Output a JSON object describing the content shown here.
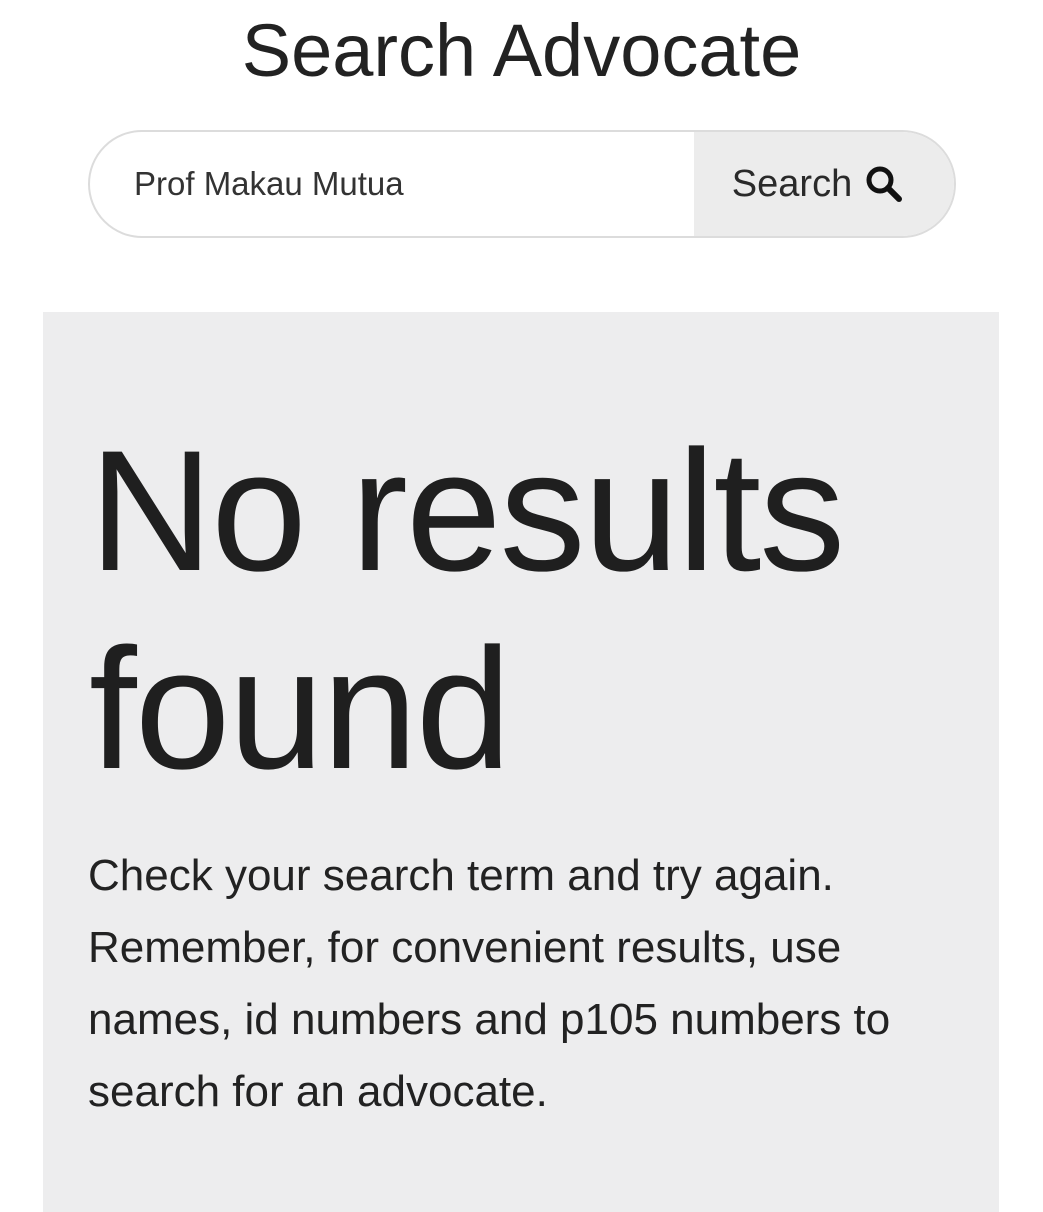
{
  "page": {
    "title": "Search Advocate"
  },
  "search": {
    "value": "Prof Makau Mutua",
    "button_label": "Search",
    "button_icon": "search-icon"
  },
  "results": {
    "heading": "No results found",
    "message": "Check your search term and try again. Remember, for convenient results, use names, id numbers and p105 numbers to search for an advocate."
  },
  "colors": {
    "panel_background": "#ededee",
    "button_background": "#ececec",
    "text": "#212121"
  }
}
